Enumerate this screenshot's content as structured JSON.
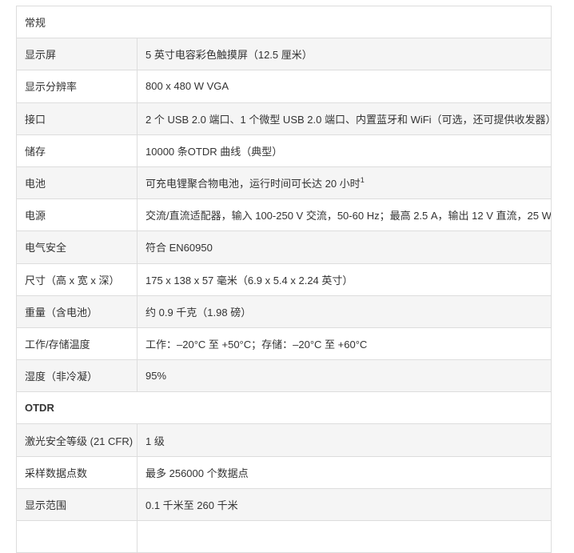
{
  "sections": [
    {
      "title": "常规",
      "rows": [
        {
          "label": "显示屏",
          "value": "5 英寸电容彩色触摸屏（12.5 厘米）"
        },
        {
          "label": "显示分辨率",
          "value": "800 x 480 W VGA"
        },
        {
          "label": "接口",
          "value": "2 个 USB 2.0 端口、1 个微型 USB 2.0 端口、内置蓝牙和 WiFi（可选，还可提供收发器）"
        },
        {
          "label": "储存",
          "value": "10000 条OTDR 曲线（典型）"
        },
        {
          "label": "电池",
          "value": "可充电锂聚合物电池，运行时间可长达 20 小时",
          "sup": "1"
        },
        {
          "label": "电源",
          "value": "交流/直流适配器，输入 100-250 V 交流，50-60 Hz；最高 2.5 A，输出 12 V 直流，25 W"
        },
        {
          "label": "电气安全",
          "value": "符合 EN60950"
        },
        {
          "label": "尺寸（高 x 宽 x 深）",
          "value": "175 x 138 x 57 毫米（6.9 x 5.4 x 2.24 英寸）"
        },
        {
          "label": "重量（含电池）",
          "value": "约 0.9 千克（1.98 磅）"
        },
        {
          "label": "工作/存储温度",
          "value": "工作：–20°C 至 +50°C；存储：–20°C 至 +60°C"
        },
        {
          "label": "湿度（非冷凝）",
          "value": "95%"
        }
      ]
    },
    {
      "title": "OTDR",
      "rows": [
        {
          "label": "激光安全等级 (21 CFR)",
          "value": "1 级"
        },
        {
          "label": "采样数据点数",
          "value": "最多 256000 个数据点"
        },
        {
          "label": "显示范围",
          "value": "0.1 千米至 260 千米"
        }
      ]
    }
  ]
}
